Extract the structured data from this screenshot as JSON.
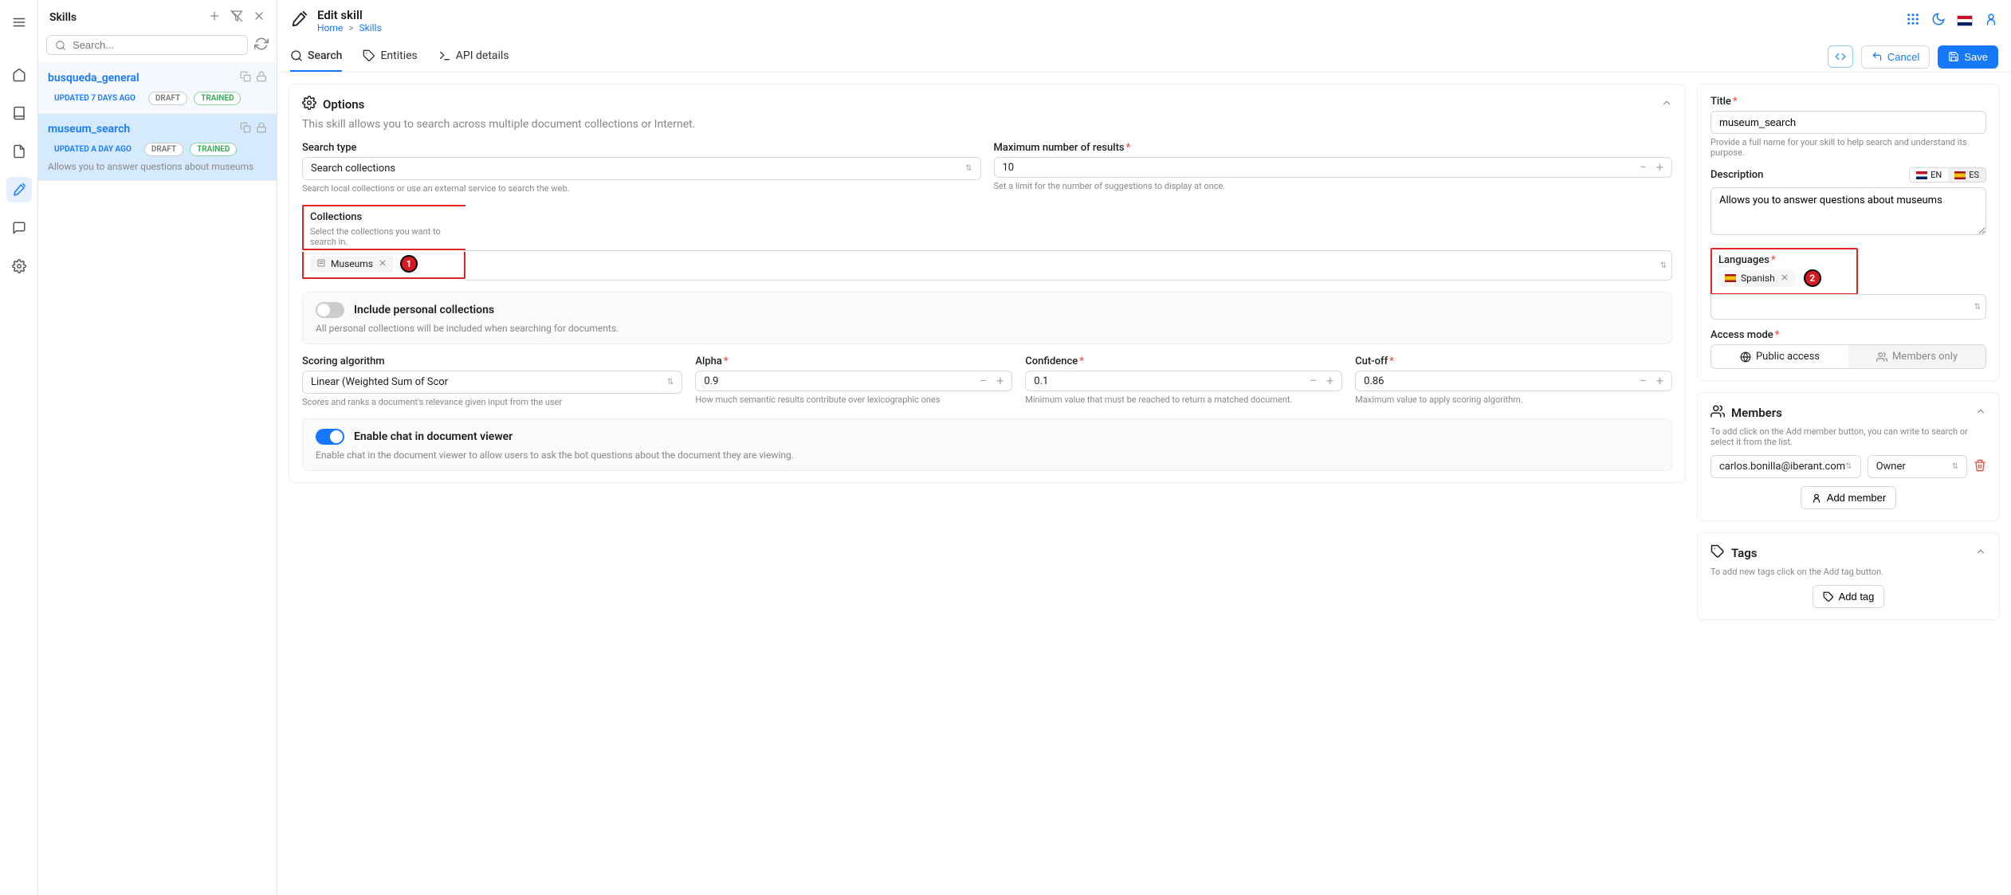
{
  "sidebar": {
    "title": "Skills",
    "searchPlaceholder": "Search...",
    "items": [
      {
        "name": "busqueda_general",
        "updated": "UPDATED 7 DAYS AGO",
        "status1": "DRAFT",
        "status2": "TRAINED"
      },
      {
        "name": "museum_search",
        "updated": "UPDATED A DAY AGO",
        "status1": "DRAFT",
        "status2": "TRAINED",
        "desc": "Allows you to answer questions about museums"
      }
    ]
  },
  "header": {
    "title": "Edit skill",
    "breadcrumbs": {
      "home": "Home",
      "skills": "Skills"
    }
  },
  "tabs": {
    "search": "Search",
    "entities": "Entities",
    "api": "API details"
  },
  "actions": {
    "cancel": "Cancel",
    "save": "Save"
  },
  "options": {
    "title": "Options",
    "desc": "This skill allows you to search across multiple document collections or Internet.",
    "searchType": {
      "label": "Search type",
      "value": "Search collections",
      "hint": "Search local collections or use an external service to search the web."
    },
    "maxResults": {
      "label": "Maximum number of results",
      "value": "10",
      "hint": "Set a limit for the number of suggestions to display at once."
    },
    "collections": {
      "label": "Collections",
      "hint": "Select the collections you want to search in.",
      "chip": "Museums",
      "marker": "1"
    },
    "personal": {
      "title": "Include personal collections",
      "desc": "All personal collections will be included when searching for documents."
    },
    "scoring": {
      "label": "Scoring algorithm",
      "value": "Linear (Weighted Sum of Scor",
      "hint": "Scores and ranks a document's relevance given input from the user"
    },
    "alpha": {
      "label": "Alpha",
      "value": "0.9",
      "hint": "How much semantic results contribute over lexicographic ones"
    },
    "confidence": {
      "label": "Confidence",
      "value": "0.1",
      "hint": "Minimum value that must be reached to return a matched document."
    },
    "cutoff": {
      "label": "Cut-off",
      "value": "0.86",
      "hint": "Maximum value to apply scoring algorithm."
    },
    "chat": {
      "title": "Enable chat in document viewer",
      "desc": "Enable chat in the document viewer to allow users to ask the bot questions about the document they are viewing."
    }
  },
  "meta": {
    "title": {
      "label": "Title",
      "value": "museum_search",
      "hint": "Provide a full name for your skill to help search and understand its purpose."
    },
    "description": {
      "label": "Description",
      "value": "Allows you to answer questions about museums"
    },
    "langToggle": {
      "en": "EN",
      "es": "ES"
    },
    "languages": {
      "label": "Languages",
      "chip": "Spanish",
      "marker": "2"
    },
    "access": {
      "label": "Access mode",
      "public": "Public access",
      "members": "Members only"
    }
  },
  "members": {
    "title": "Members",
    "hint": "To add click on the Add member button, you can write to search or select it from the list.",
    "entry": "carlos.bonilla@iberant.com",
    "role": "Owner",
    "add": "Add member"
  },
  "tags": {
    "title": "Tags",
    "hint": "To add new tags click on the Add tag button.",
    "add": "Add tag"
  }
}
